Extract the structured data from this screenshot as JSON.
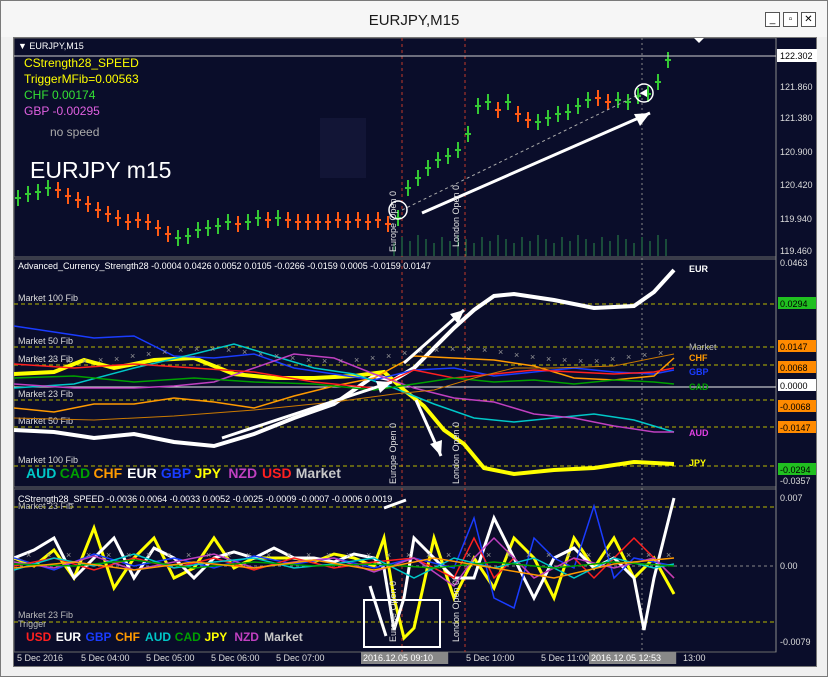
{
  "window": {
    "title": "EURJPY,M15"
  },
  "controls": {
    "minimize": "_",
    "restore": "▫",
    "close": "✕"
  },
  "main": {
    "symbol_label": "EURJPY,M15",
    "indicator_name": "CStrength28_SPEED",
    "trigger": "TriggerMFib=0.00563",
    "chf": "CHF 0.00174",
    "gbp": "GBP -0.00295",
    "no_speed": "no speed",
    "watermark": "EURJPY m15",
    "prices": [
      "122.302",
      "121.860",
      "121.380",
      "120.900",
      "120.420",
      "119.940",
      "119.460"
    ],
    "europe_open": "Europe Open 0",
    "london_open": "London Open 0"
  },
  "acs": {
    "header": "Advanced_Currency_Strength28  -0.0004 0.0426 0.0052 0.0105 -0.0266 -0.0159 0.0005 -0.0159 0.0147",
    "fibs": [
      "Market 100 Fib",
      "Market 50 Fib",
      "Market 23 Fib",
      "Market 23 Fib",
      "Market 50 Fib",
      "Market 100 Fib"
    ],
    "axis": [
      "0.0463",
      "0.0294",
      "0.0147",
      "0.0068",
      "0.0000",
      "-0.0068",
      "-0.0147",
      "-0.0294",
      "-0.0357"
    ],
    "right_labels": {
      "eur": "EUR",
      "market": "Market",
      "chf": "CHF",
      "gbp": "GBP",
      "cad": "CAD",
      "aud": "AUD",
      "jpy": "JPY"
    },
    "legend": [
      {
        "text": "AUD",
        "color": "#00c8c8"
      },
      {
        "text": "CAD",
        "color": "#00a000"
      },
      {
        "text": "CHF",
        "color": "#ff9a00"
      },
      {
        "text": "EUR",
        "color": "#ffffff"
      },
      {
        "text": "GBP",
        "color": "#1a3cff"
      },
      {
        "text": "JPY",
        "color": "#ffff00"
      },
      {
        "text": "NZD",
        "color": "#c040c0"
      },
      {
        "text": "USD",
        "color": "#ff2020"
      },
      {
        "text": "Market",
        "color": "#c8c8c8"
      }
    ]
  },
  "speed": {
    "header": "CStrength28_SPEED  -0.0036 0.0064 -0.0033 0.0052 -0.0025 -0.0009 -0.0007 -0.0006 0.0019",
    "fib_top": "Market 23 Fib",
    "fib_bottom": "Market 23 Fib",
    "trigger": "Trigger",
    "axis": [
      "0.007",
      "0.00",
      "-0.0079"
    ],
    "legend": [
      {
        "text": "USD",
        "color": "#ff2020"
      },
      {
        "text": "EUR",
        "color": "#ffffff"
      },
      {
        "text": "GBP",
        "color": "#1a3cff"
      },
      {
        "text": "CHF",
        "color": "#ff9a00"
      },
      {
        "text": "AUD",
        "color": "#00c8c8"
      },
      {
        "text": "CAD",
        "color": "#00a000"
      },
      {
        "text": "JPY",
        "color": "#ffff00"
      },
      {
        "text": "NZD",
        "color": "#c040c0"
      },
      {
        "text": "Market",
        "color": "#c8c8c8"
      }
    ]
  },
  "time_axis": [
    "5 Dec 2016",
    "5 Dec 04:00",
    "5 Dec 05:00",
    "5 Dec 06:00",
    "5 Dec 07:00",
    "2016.12.05 09:10",
    "5 Dec 10:00",
    "5 Dec 11:00",
    "2016.12.05 12:53",
    "13:00"
  ],
  "colors": {
    "bg": "#0a0d2a",
    "bull": "#34c834",
    "bear": "#ff5a14",
    "fib": "#b8b800",
    "axis_box_green": "#20c020",
    "axis_box_orange": "#ff8a00"
  }
}
